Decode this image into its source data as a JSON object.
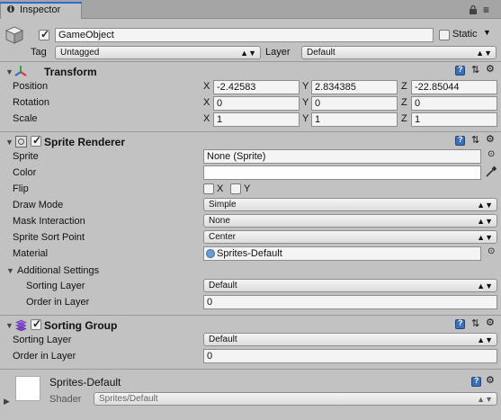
{
  "tab": {
    "title": "Inspector"
  },
  "header": {
    "name": "GameObject",
    "static_label": "Static",
    "tag_label": "Tag",
    "tag_value": "Untagged",
    "layer_label": "Layer",
    "layer_value": "Default"
  },
  "transform": {
    "title": "Transform",
    "position": {
      "label": "Position",
      "x": "-2.42583",
      "y": "2.834385",
      "z": "-22.85044"
    },
    "rotation": {
      "label": "Rotation",
      "x": "0",
      "y": "0",
      "z": "0"
    },
    "scale": {
      "label": "Scale",
      "x": "1",
      "y": "1",
      "z": "1"
    },
    "axis_x": "X",
    "axis_y": "Y",
    "axis_z": "Z"
  },
  "sprite_renderer": {
    "title": "Sprite Renderer",
    "sprite": {
      "label": "Sprite",
      "value": "None (Sprite)"
    },
    "color": {
      "label": "Color",
      "value": "#ffffff"
    },
    "flip": {
      "label": "Flip",
      "x": "X",
      "y": "Y"
    },
    "draw_mode": {
      "label": "Draw Mode",
      "value": "Simple"
    },
    "mask_interaction": {
      "label": "Mask Interaction",
      "value": "None"
    },
    "sort_point": {
      "label": "Sprite Sort Point",
      "value": "Center"
    },
    "material": {
      "label": "Material",
      "value": "Sprites-Default"
    },
    "additional": {
      "label": "Additional Settings",
      "sorting_layer": {
        "label": "Sorting Layer",
        "value": "Default"
      },
      "order": {
        "label": "Order in Layer",
        "value": "0"
      }
    }
  },
  "sorting_group": {
    "title": "Sorting Group",
    "sorting_layer": {
      "label": "Sorting Layer",
      "value": "Default"
    },
    "order": {
      "label": "Order in Layer",
      "value": "0"
    }
  },
  "material_panel": {
    "name": "Sprites-Default",
    "shader_label": "Shader",
    "shader_value": "Sprites/Default"
  },
  "icons": [
    "inspector-icon",
    "lock-icon",
    "more-icon",
    "cube-icon",
    "transform-icon",
    "sprite-renderer-icon",
    "sorting-group-icon",
    "help-icon",
    "presets-icon",
    "gear-icon",
    "picker-icon",
    "eyedropper-icon",
    "sprite-material-icon"
  ],
  "colors": {
    "accent_tab": "#2f6ad8",
    "panel_bg": "#c2c2c2",
    "help_icon": "#3b6fb6",
    "sorting_group_icon": "#8a4fd6"
  }
}
